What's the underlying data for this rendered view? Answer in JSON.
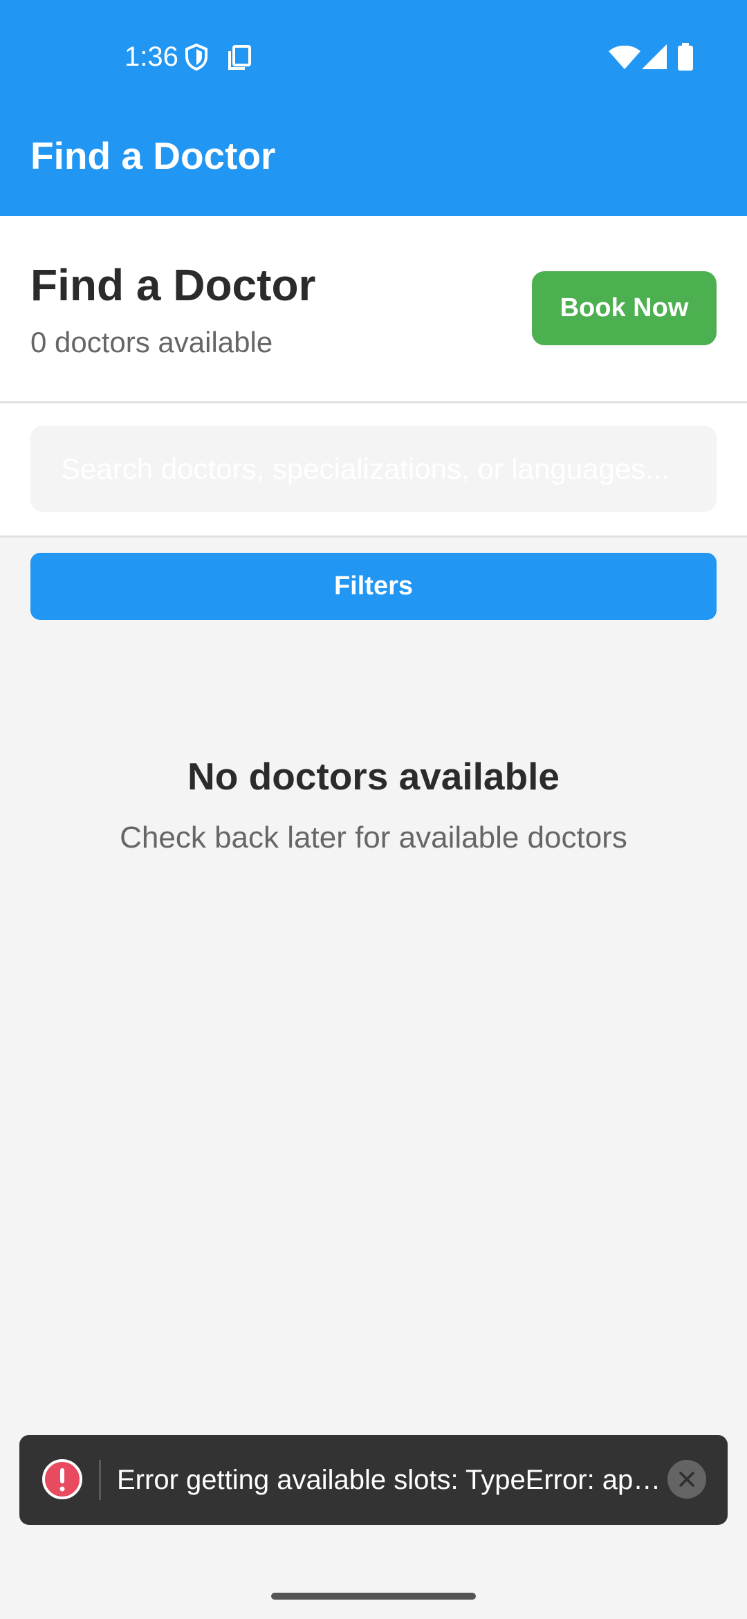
{
  "status_bar": {
    "time": "1:36",
    "icons": [
      "shield-icon",
      "copy-icon",
      "wifi-icon",
      "signal-icon",
      "battery-icon"
    ]
  },
  "app_bar": {
    "title": "Find a Doctor"
  },
  "header": {
    "title": "Find a Doctor",
    "subtitle": "0 doctors available",
    "book_button": "Book Now"
  },
  "search": {
    "placeholder": "Search doctors, specializations, or languages..."
  },
  "filters": {
    "label": "Filters"
  },
  "empty_state": {
    "title": "No doctors available",
    "message": "Check back later for available doctors"
  },
  "toast": {
    "icon": "error-icon",
    "message": "Error getting available slots: TypeError: app…",
    "close_icon": "close-icon"
  },
  "colors": {
    "primary": "#2196f3",
    "success": "#4caf50",
    "error": "#e84a5f",
    "toast_bg": "#333333",
    "background": "#f4f4f4"
  }
}
